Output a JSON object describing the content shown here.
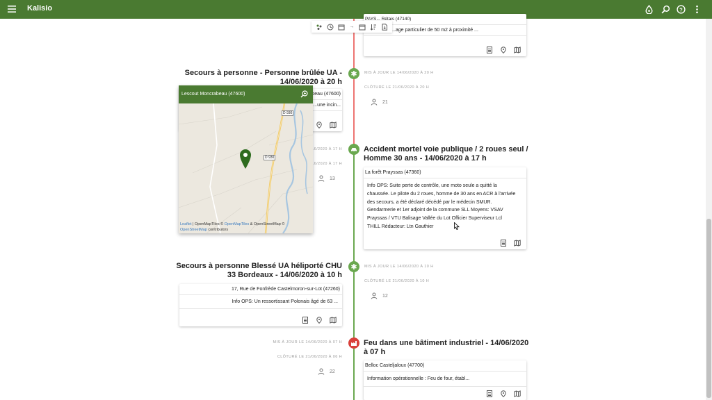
{
  "app": {
    "title": "Kalisio"
  },
  "icons": {
    "menu": "menu-icon",
    "weather": "drop-icon",
    "search": "search-icon",
    "help": "help-icon",
    "more": "more-vertical-icon"
  },
  "colors": {
    "brand": "#4a7a31",
    "timeline": "#6aa84f",
    "fire": "#d9413b"
  },
  "top_card": {
    "location": "PAYS... Rétais (47140)",
    "info": "...age particulier de 50 m2 à proximité ..."
  },
  "events": [
    {
      "title_line1": "Secours à personne - Personne brûlée UA -",
      "title_line2": "14/06/2020 à 20 h",
      "updated": "MIS À JOUR LE 14/06/2020 À 20 H",
      "closed": "CLÔTURÉ LE 21/06/2020 À 20 H",
      "location": "...beau (47600)",
      "info": "...une incin...",
      "participants": "21"
    },
    {
      "title_line1": "Accident mortel voie publique / 2 roues seul /",
      "title_line2": "Homme 30 ans - 14/06/2020 à 17 h",
      "updated": "...6/2020 À 17 H",
      "closed": "...6/2020 À 17 H",
      "location": "La forêt Prayssas (47360)",
      "info_lines": [
        "Info OPS: Suite perte de contrôle, une moto seule a quitté la",
        "chaussée. Le pilote du 2 roues, homme de 30 ans en ACR à l'arrivée",
        "des secours, a été déclaré décédé par le médecin SMUR.",
        "Gendarmerie et 1er adjoint de la commune SLL Moyens: VSAV",
        "Prayssas / VTU Balisage Vallée du Lot Officier Superviseur Lcl",
        "THILL Rédacteur: Ltn Gauthier"
      ],
      "participants": "13"
    },
    {
      "title_line1": "Secours à personne Blessé UA héliporté CHU",
      "title_line2": "33 Bordeaux - 14/06/2020 à 10 h",
      "updated": "MIS À JOUR LE 14/06/2020 À 10 H",
      "closed": "CLÔTURÉ LE 21/06/2020 À 10 H",
      "location": "17, Rue de Fonfrède Castelmoron-sur-Lot (47260)",
      "info": "Info OPS: Un ressortissant Polonais âgé de 63 ...",
      "participants": "12"
    },
    {
      "title_line1": "Feu dans une bâtiment industriel - 14/06/2020",
      "title_line2": "à 07 h",
      "updated": "MIS À JOUR LE 14/06/2020 À 07 H",
      "closed": "CLÔTURÉ LE 21/06/2020 À 06 H",
      "location": "Belloc Casteljaloux (47700)",
      "info": "Information opérationnelle : Feu de four, établ...",
      "participants": "22"
    }
  ],
  "map_popup": {
    "title": "Lescout Moncrabeau (47600)",
    "road_labels": [
      "D 930",
      "D 930"
    ],
    "attribution_leaflet": "Leaflet",
    "attribution_text1": " | OpenMapTiles © ",
    "attribution_link1": "OpenMapTiles",
    "attribution_text2": " & OpenStreetMap ©",
    "attribution_link2": "OpenStreetMap",
    "attribution_text3": " contributors"
  }
}
